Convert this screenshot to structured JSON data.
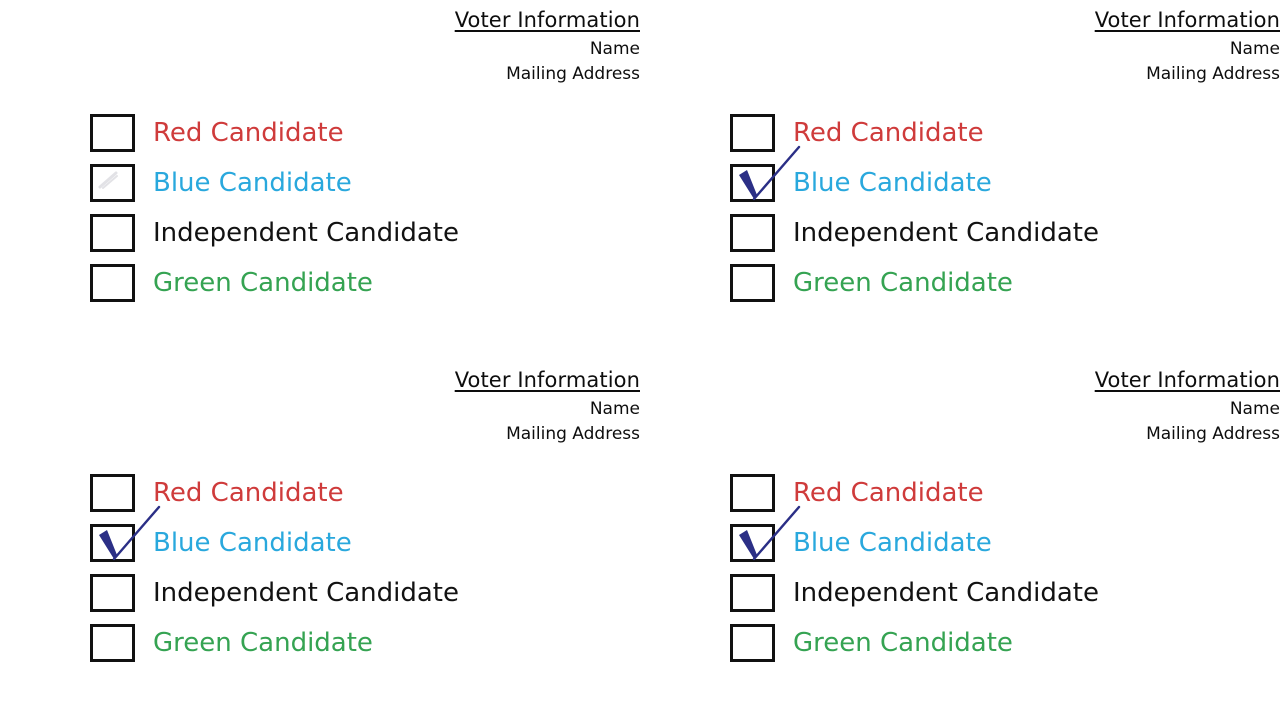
{
  "page": {
    "background_color": "#ffffff",
    "ink_color": "#0d0d0d",
    "check_color": "#2b2f86"
  },
  "colors": {
    "red": "#cf3b3b",
    "blue": "#29a8dd",
    "independent": "#121212",
    "green": "#35a352",
    "checkbox_border": "#111111",
    "check_mark": "#2b2f86"
  },
  "voter_info": {
    "title": "Voter Information",
    "name_label": "Name",
    "address_label": "Mailing Address"
  },
  "candidates": {
    "red": "Red Candidate",
    "blue": "Blue Candidate",
    "independent": "Independent Candidate",
    "green": "Green Candidate"
  },
  "ballots": [
    {
      "id": "ballot-top-left",
      "position": "top-left",
      "voter_info": {
        "title": "Voter Information",
        "name_label": "Name",
        "address_label": "Mailing Address"
      },
      "options": [
        {
          "label": "Red Candidate",
          "color_key": "red",
          "checked": false,
          "faint_mark": false
        },
        {
          "label": "Blue Candidate",
          "color_key": "blue",
          "checked": false,
          "faint_mark": true
        },
        {
          "label": "Independent Candidate",
          "color_key": "independent",
          "checked": false,
          "faint_mark": false
        },
        {
          "label": "Green Candidate",
          "color_key": "green",
          "checked": false,
          "faint_mark": false
        }
      ]
    },
    {
      "id": "ballot-top-right",
      "position": "top-right",
      "voter_info": {
        "title": "Voter Information",
        "name_label": "Name",
        "address_label": "Mailing Address"
      },
      "options": [
        {
          "label": "Red Candidate",
          "color_key": "red",
          "checked": false,
          "faint_mark": false
        },
        {
          "label": "Blue Candidate",
          "color_key": "blue",
          "checked": true,
          "faint_mark": false
        },
        {
          "label": "Independent Candidate",
          "color_key": "independent",
          "checked": false,
          "faint_mark": false
        },
        {
          "label": "Green Candidate",
          "color_key": "green",
          "checked": false,
          "faint_mark": false
        }
      ]
    },
    {
      "id": "ballot-bottom-left",
      "position": "bottom-left",
      "voter_info": {
        "title": "Voter Information",
        "name_label": "Name",
        "address_label": "Mailing Address"
      },
      "options": [
        {
          "label": "Red Candidate",
          "color_key": "red",
          "checked": false,
          "faint_mark": false
        },
        {
          "label": "Blue Candidate",
          "color_key": "blue",
          "checked": true,
          "faint_mark": false
        },
        {
          "label": "Independent Candidate",
          "color_key": "independent",
          "checked": false,
          "faint_mark": false
        },
        {
          "label": "Green Candidate",
          "color_key": "green",
          "checked": false,
          "faint_mark": false
        }
      ]
    },
    {
      "id": "ballot-bottom-right",
      "position": "bottom-right",
      "voter_info": {
        "title": "Voter Information",
        "name_label": "Name",
        "address_label": "Mailing Address"
      },
      "options": [
        {
          "label": "Red Candidate",
          "color_key": "red",
          "checked": false,
          "faint_mark": false
        },
        {
          "label": "Blue Candidate",
          "color_key": "blue",
          "checked": true,
          "faint_mark": false
        },
        {
          "label": "Independent Candidate",
          "color_key": "independent",
          "checked": false,
          "faint_mark": false
        },
        {
          "label": "Green Candidate",
          "color_key": "green",
          "checked": false,
          "faint_mark": false
        }
      ]
    }
  ]
}
